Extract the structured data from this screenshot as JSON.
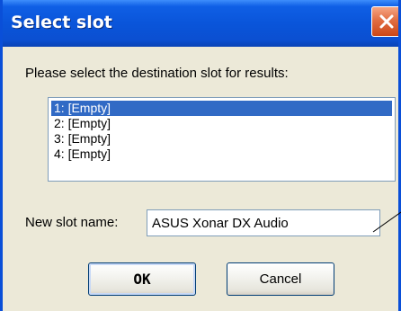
{
  "dialog": {
    "title": "Select slot",
    "close_icon": "close-icon",
    "prompt": "Please select the destination slot for results:",
    "slots": [
      {
        "label": "1: [Empty]",
        "selected": true
      },
      {
        "label": "2: [Empty]",
        "selected": false
      },
      {
        "label": "3: [Empty]",
        "selected": false
      },
      {
        "label": "4: [Empty]",
        "selected": false
      }
    ],
    "new_slot_name_label": "New slot name:",
    "new_slot_name_value": "ASUS Xonar DX Audio",
    "ok_label": "OK",
    "cancel_label": "Cancel"
  },
  "colors": {
    "titlebar": "#0a55da",
    "close_button": "#e26e43",
    "selection": "#316ac5",
    "dialog_background": "#ece9d8"
  }
}
